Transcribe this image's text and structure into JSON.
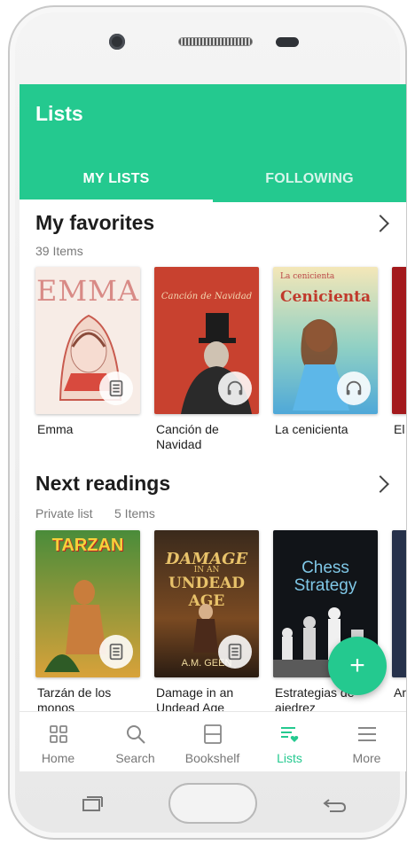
{
  "appbar": {
    "title": "Lists"
  },
  "tabs": [
    {
      "label": "MY LISTS",
      "active": true
    },
    {
      "label": "FOLLOWING",
      "active": false
    }
  ],
  "sections": [
    {
      "title": "My favorites",
      "meta": "39 Items",
      "books": [
        {
          "title": "Emma",
          "format": "ebook"
        },
        {
          "title": "Canción de Navidad",
          "format": "audiobook"
        },
        {
          "title": "La cenicienta",
          "format": "audiobook"
        },
        {
          "title": "El",
          "format": ""
        }
      ]
    },
    {
      "title": "Next readings",
      "meta_privacy": "Private list",
      "meta_count": "5 Items",
      "books": [
        {
          "title": "Tarzán de los monos",
          "format": "ebook"
        },
        {
          "title": "Damage in an Undead Age",
          "format": "ebook"
        },
        {
          "title": "Estrategias de ajedrez",
          "format": ""
        },
        {
          "title": "Ar co",
          "format": ""
        }
      ]
    }
  ],
  "covers": {
    "emma": "EMMA",
    "cancion": "Canción de Navidad",
    "cenicienta_top": "La cenicienta",
    "cenicienta": "Cenicienta",
    "tarzan": "TARZAN",
    "damage_1": "DAMAGE",
    "damage_2": "IN AN",
    "damage_3": "UNDEAD AGE",
    "damage_author": "A.M. GEEN",
    "chess_1": "Chess",
    "chess_2": "Strategy"
  },
  "fab": {
    "icon": "plus-icon",
    "label": "+"
  },
  "bottom_nav": [
    {
      "label": "Home",
      "icon": "home-grid-icon",
      "active": false
    },
    {
      "label": "Search",
      "icon": "search-icon",
      "active": false
    },
    {
      "label": "Bookshelf",
      "icon": "bookshelf-icon",
      "active": false
    },
    {
      "label": "Lists",
      "icon": "lists-heart-icon",
      "active": true
    },
    {
      "label": "More",
      "icon": "menu-icon",
      "active": false
    }
  ],
  "colors": {
    "accent": "#24c98f",
    "text": "#1d1d1d",
    "muted": "#7a7a7a"
  }
}
